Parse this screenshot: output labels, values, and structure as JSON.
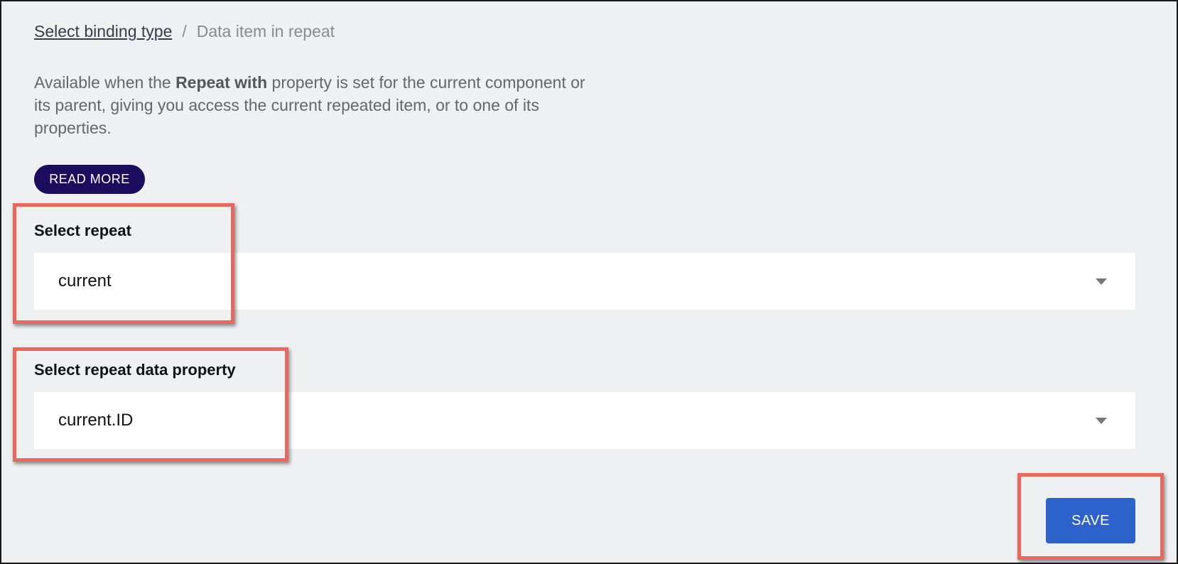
{
  "breadcrumb": {
    "link_label": "Select binding type",
    "separator": "/",
    "current_label": "Data item in repeat"
  },
  "description": {
    "prefix": "Available when the ",
    "emphasis": "Repeat with",
    "suffix": " property is set for the current component or its parent, giving you access the current repeated item, or to one of its properties."
  },
  "read_more_label": "READ MORE",
  "repeat_select": {
    "label": "Select repeat",
    "value": "current"
  },
  "property_select": {
    "label": "Select repeat data property",
    "value": "current.ID"
  },
  "save_label": "SAVE",
  "colors": {
    "background": "#eef0f2",
    "read_more_bg": "#1c0c5e",
    "save_bg": "#2c62c9",
    "highlight": "#e8685b"
  }
}
